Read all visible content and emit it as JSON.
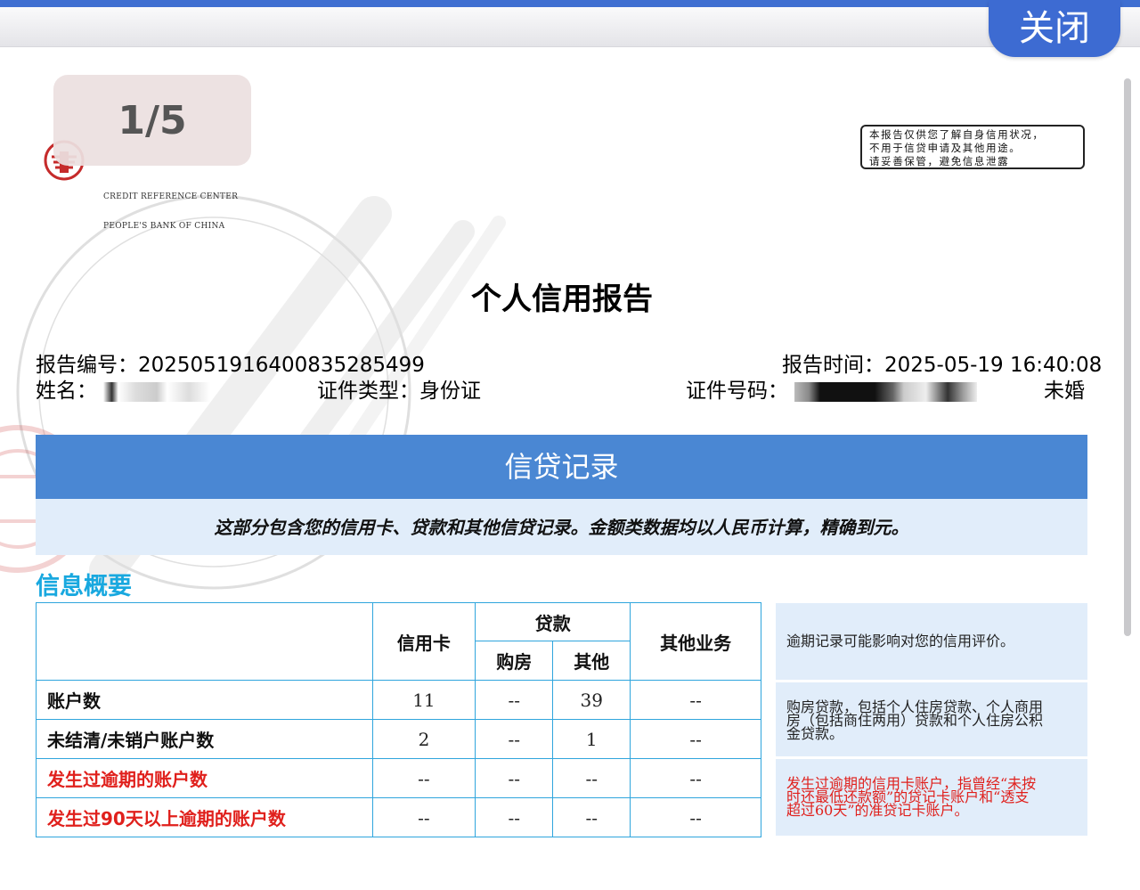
{
  "viewer": {
    "close_label": "关闭",
    "page_indicator": "1/5"
  },
  "header": {
    "logo_en_line1": "CREDIT REFERENCE CENTER",
    "logo_en_line2": "PEOPLE'S BANK OF CHINA",
    "notice_lines": [
      "本报告仅供您了解自身信用状况，",
      "不用于信贷申请及其他用途。",
      "请妥善保管，避免信息泄露"
    ]
  },
  "report": {
    "title": "个人信用报告",
    "number_label": "报告编号：",
    "number_value": "2025051916400835285499",
    "time_label": "报告时间：",
    "time_value": "2025-05-19 16:40:08",
    "name_label": "姓名：",
    "id_type_label": "证件类型：",
    "id_type_value": "身份证",
    "id_number_label": "证件号码：",
    "marital_status": "未婚"
  },
  "section": {
    "title": "信贷记录",
    "description": "这部分包含您的信用卡、贷款和其他信贷记录。金额类数据均以人民币计算，精确到元。",
    "summary_title": "信息概要"
  },
  "summary_table": {
    "headers": {
      "credit_card": "信用卡",
      "loan": "贷款",
      "loan_house": "购房",
      "loan_other": "其他",
      "other_business": "其他业务"
    },
    "rows": [
      {
        "label": "账户数",
        "credit_card": "11",
        "house": "--",
        "other": "39",
        "other_business": "--"
      },
      {
        "label": "未结清/未销户账户数",
        "credit_card": "2",
        "house": "--",
        "other": "1",
        "other_business": "--"
      },
      {
        "label": "发生过逾期的账户数",
        "credit_card": "--",
        "house": "--",
        "other": "--",
        "other_business": "--"
      },
      {
        "label": "发生过90天以上逾期的账户数",
        "credit_card": "--",
        "house": "--",
        "other": "--",
        "other_business": "--"
      }
    ],
    "highlight_color": "#e0201c",
    "border_color": "#2fa5dd"
  },
  "notes": {
    "note1": "逾期记录可能影响对您的信用评价。",
    "note2_lines": [
      "购房贷款，包括个人住房贷款、个人商用",
      "房（包括商住两用）贷款和个人住房公积",
      "金贷款。"
    ],
    "note3_lines": [
      "发生过逾期的信用卡账户，指曾经“未按",
      "时还最低还款额”的贷记卡账户和“透支",
      "超过60天”的准贷记卡账户。"
    ]
  },
  "colors": {
    "band_blue": "#4a87d3",
    "band_light": "#e1edfa",
    "subtitle_cyan": "#18a8df",
    "close_button": "#3d6bd2"
  }
}
